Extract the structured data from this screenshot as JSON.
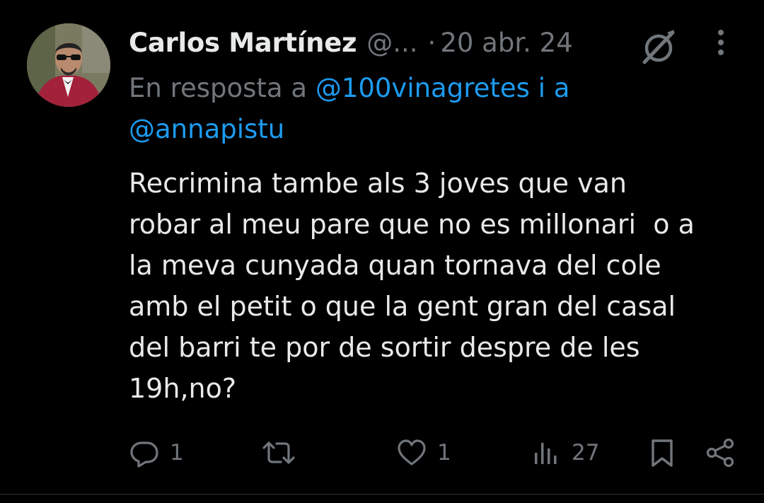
{
  "author": {
    "name": "Carlos Martínez",
    "handle": "@...",
    "separator": "·",
    "date": "20 abr. 24"
  },
  "reply": {
    "prefix": "En resposta a ",
    "mention1": "@100vinagretes",
    "joiner": " i a ",
    "mention2": "@annapistu"
  },
  "tweet_text": "Recrimina tambe als 3 joves que van\nrobar al meu pare que no es millonari  o a\nla meva cunyada quan tornava del cole\namb el petit o que la gent gran del casal\ndel barri te por de sortir despre de les\n19h,no?",
  "actions": {
    "reply_count": "1",
    "retweet_count": "",
    "like_count": "1",
    "views_count": "27"
  },
  "icons": {
    "grok": "grok-icon",
    "more": "more-vertical-icon",
    "reply": "reply-icon",
    "retweet": "retweet-icon",
    "like": "heart-icon",
    "views": "views-icon",
    "bookmark": "bookmark-icon",
    "share": "share-icon"
  },
  "colors": {
    "background": "#000000",
    "primary_text": "#e7e9ea",
    "secondary_text": "#71767b",
    "link": "#1d9bf0",
    "divider": "#2f3336"
  }
}
